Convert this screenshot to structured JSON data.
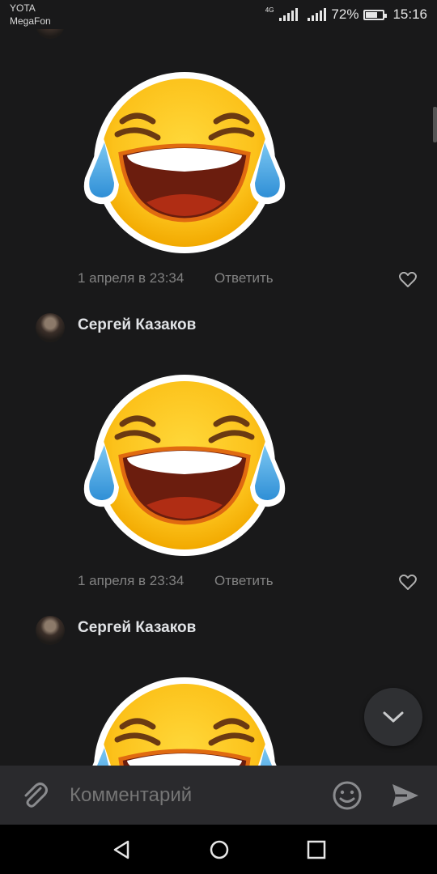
{
  "status_bar": {
    "carrier_1": "YOTA",
    "carrier_2": "MegaFon",
    "network": "4G",
    "battery_percent": "72%",
    "battery_level": 0.72,
    "time": "15:16"
  },
  "comments": [
    {
      "author": "",
      "sticker_icon": "tears-of-joy-emoji-sticker",
      "timestamp": "1 апреля в 23:34",
      "reply_label": "Ответить",
      "like_icon": "heart-outline-icon"
    },
    {
      "author": "Сергей Казаков",
      "sticker_icon": "tears-of-joy-emoji-sticker",
      "timestamp": "1 апреля в 23:34",
      "reply_label": "Ответить",
      "like_icon": "heart-outline-icon"
    },
    {
      "author": "Сергей Казаков",
      "sticker_icon": "tears-of-joy-emoji-sticker"
    }
  ],
  "composer": {
    "placeholder": "Комментарий",
    "attach_icon": "paperclip-icon",
    "emoji_icon": "smile-icon",
    "send_icon": "send-icon"
  },
  "scroll_down_icon": "chevron-down-icon",
  "colors": {
    "background": "#19191a",
    "composer_bg": "#2a2a2d",
    "secondary_text": "#828282",
    "emoji_yellow": "#fcc21b",
    "tear_blue": "#4aa6e0"
  }
}
